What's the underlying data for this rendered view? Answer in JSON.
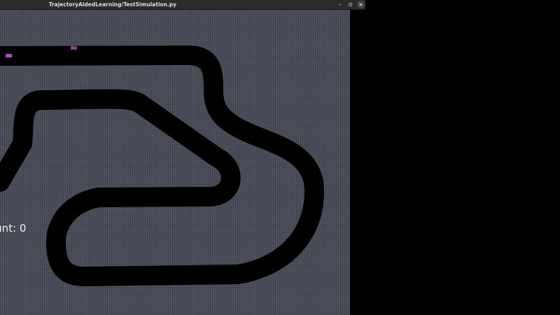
{
  "window": {
    "title": "TrajectoryAidedLearning/TestSimulation.py",
    "minimize_glyph": "–",
    "maximize_glyph": "⊙",
    "close_glyph": "×"
  },
  "simulation": {
    "counter_text": "ount: 0",
    "track_color": "#000000",
    "background_color": "#515460",
    "car_color": "#b150b8"
  }
}
